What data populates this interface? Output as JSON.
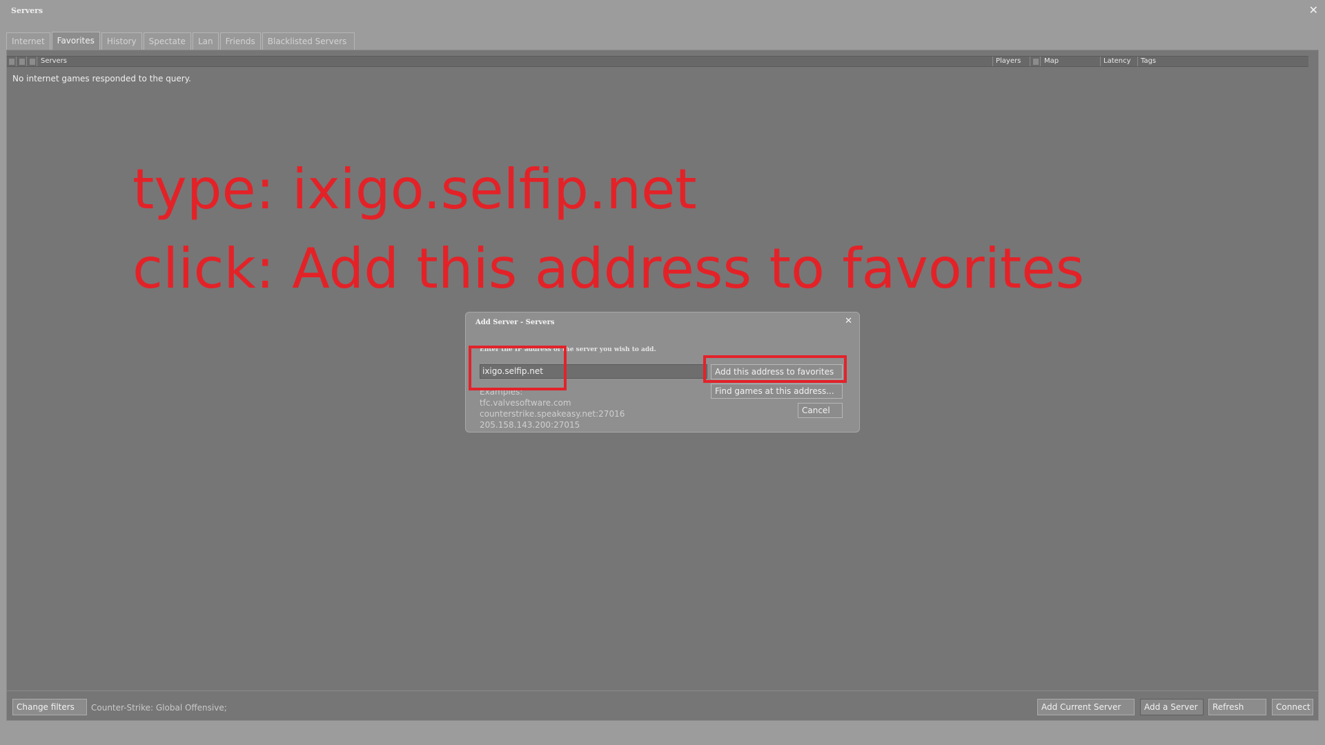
{
  "window": {
    "title": "Servers",
    "close_glyph": "✕"
  },
  "tabs": [
    "Internet",
    "Favorites",
    "History",
    "Spectate",
    "Lan",
    "Friends",
    "Blacklisted Servers"
  ],
  "active_tab": "Favorites",
  "columns": {
    "servers": "Servers",
    "players": "Players",
    "map": "Map",
    "latency": "Latency",
    "tags": "Tags"
  },
  "empty_message": "No internet games responded to the query.",
  "annotation": {
    "line1": "type: ixigo.selfip.net",
    "line2": "click: Add this address to favorites",
    "color": "#e32228"
  },
  "bottom": {
    "change_filters": "Change filters",
    "filter_info": "Counter-Strike: Global Offensive;",
    "add_current_server": "Add Current Server",
    "add_a_server": "Add a Server",
    "refresh": "Refresh",
    "connect": "Connect"
  },
  "dialog": {
    "title": "Add Server - Servers",
    "close_glyph": "✕",
    "prompt": "Enter the IP address of the server you wish to add.",
    "input_value": "ixigo.selfip.net",
    "examples_label": "Examples:",
    "examples": [
      "tfc.valvesoftware.com",
      "counterstrike.speakeasy.net:27016",
      "205.158.143.200:27015"
    ],
    "add_favorites": "Add this address to favorites",
    "find_games": "Find games at this address...",
    "cancel": "Cancel"
  }
}
